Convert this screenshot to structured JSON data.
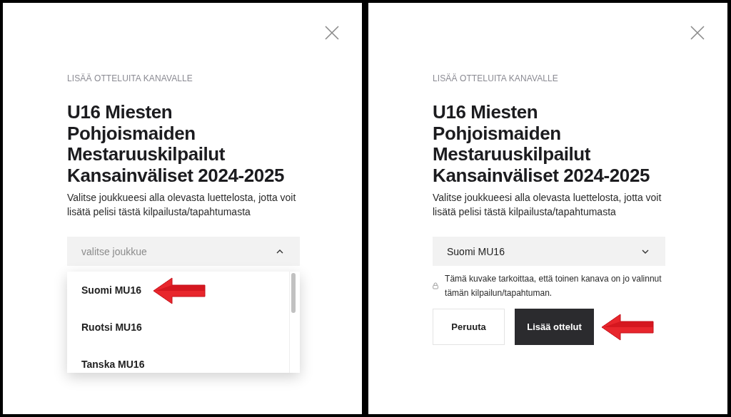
{
  "panels": [
    {
      "eyebrow": "LISÄÄ OTTELUITA KANAVALLE",
      "title": "U16 Miesten Pohjoismaiden Mestaruuskilpailut Kansainväliset 2024-2025",
      "description": "Valitse joukkueesi alla olevasta luettelosta, jotta voit lisätä pelisi tästä kilpailusta/tapahtumasta",
      "select": {
        "placeholder": "valitse joukkue",
        "expanded": true
      },
      "options": [
        {
          "label": "Suomi MU16",
          "highlighted": true
        },
        {
          "label": "Ruotsi MU16",
          "highlighted": false
        },
        {
          "label": "Tanska MU16",
          "highlighted": false
        }
      ]
    },
    {
      "eyebrow": "LISÄÄ OTTELUITA KANAVALLE",
      "title": "U16 Miesten Pohjoismaiden Mestaruuskilpailut Kansainväliset 2024-2025",
      "description": "Valitse joukkueesi alla olevasta luettelosta, jotta voit lisätä pelisi tästä kilpailusta/tapahtumasta",
      "select": {
        "value": "Suomi MU16",
        "expanded": false
      },
      "note": "Tämä kuvake tarkoittaa, että toinen kanava on jo valinnut tämän kilpailun/tapahtuman.",
      "buttons": [
        {
          "label": "Peruuta",
          "kind": "secondary",
          "highlighted": false
        },
        {
          "label": "Lisää ottelut",
          "kind": "primary",
          "highlighted": true
        }
      ]
    }
  ]
}
